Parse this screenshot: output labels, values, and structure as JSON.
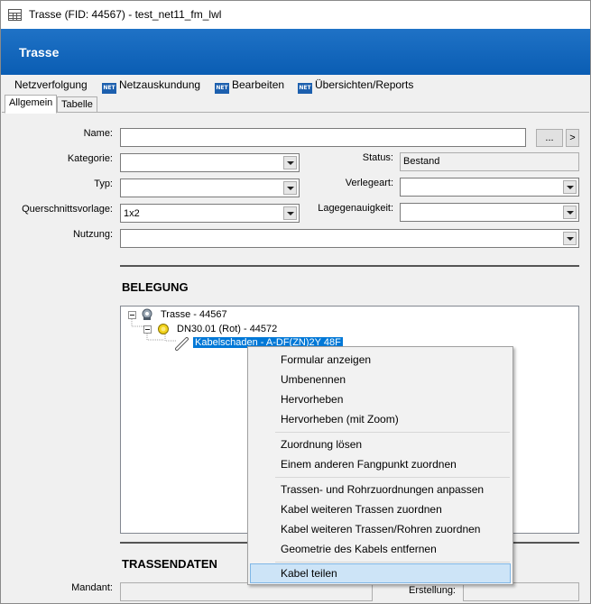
{
  "window": {
    "title": "Trasse (FID: 44567) - test_net11_fm_lwl"
  },
  "header": {
    "title": "Trasse"
  },
  "menu": {
    "items": [
      {
        "label": "Netzverfolgung",
        "badge": ""
      },
      {
        "label": "Netzauskundung",
        "badge": "NET"
      },
      {
        "label": "Bearbeiten",
        "badge": "NET"
      },
      {
        "label": "Übersichten/Reports",
        "badge": "NET"
      }
    ]
  },
  "tabs": [
    {
      "label": "Allgemein",
      "active": true
    },
    {
      "label": "Tabelle",
      "active": false
    }
  ],
  "form": {
    "name_label": "Name:",
    "name_value": "",
    "browse_button": "...",
    "next_button": ">",
    "kategorie_label": "Kategorie:",
    "kategorie_value": "",
    "status_label": "Status:",
    "status_value": "Bestand",
    "typ_label": "Typ:",
    "typ_value": "",
    "verlegeart_label": "Verlegeart:",
    "verlegeart_value": "",
    "querschnitt_label": "Querschnittsvorlage:",
    "querschnitt_value": "1x2",
    "lagegenauigkeit_label": "Lagegenauigkeit:",
    "lagegenauigkeit_value": "",
    "nutzung_label": "Nutzung:",
    "nutzung_value": ""
  },
  "belegung": {
    "title": "BELEGUNG",
    "tree": [
      {
        "label": "Trasse - 44567",
        "icon": "trasse-icon"
      },
      {
        "label": "DN30.01 (Rot) - 44572",
        "icon": "pipe-yellow-circle-icon"
      },
      {
        "label": "Kabelschaden - A-DF(ZN)2Y 48F",
        "icon": "cable-icon",
        "selected": true
      }
    ]
  },
  "context_menu": {
    "items": [
      "Formular anzeigen",
      "Umbenennen",
      "Hervorheben",
      "Hervorheben (mit Zoom)",
      "Zuordnung lösen",
      "Einem anderen Fangpunkt zuordnen",
      "Trassen- und Rohrzuordnungen anpassen",
      "Kabel weiteren Trassen zuordnen",
      "Kabel weiteren Trassen/Rohren zuordnen",
      "Geometrie des Kabels entfernen",
      "Kabel teilen"
    ],
    "hovered": "Kabel teilen"
  },
  "trassendaten": {
    "title": "TRASSENDATEN",
    "mandant_label": "Mandant:",
    "mandant_value": "",
    "erstellung_label": "Erstellung:",
    "erstellung_value": ""
  },
  "colors": {
    "header_blue": "#0a5db3",
    "selection_blue": "#0078d7",
    "hover_blue": "#cde4f7"
  }
}
